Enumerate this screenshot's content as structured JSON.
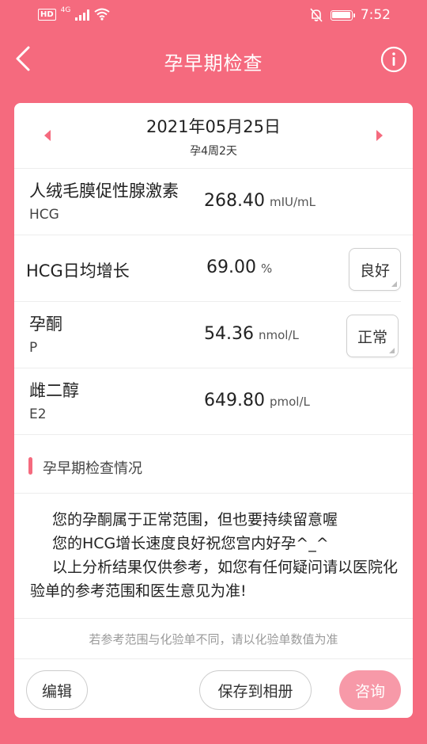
{
  "status_bar": {
    "hd": "HD",
    "network": "4G",
    "time": "7:52"
  },
  "header": {
    "title": "孕早期检查"
  },
  "date": {
    "text": "2021年05月25日",
    "week": "孕4周2天"
  },
  "tests": [
    {
      "name": "人绒毛膜促性腺激素",
      "sub": "HCG",
      "value": "268.40",
      "unit": "mIU/mL"
    },
    {
      "name": "HCG日均增长",
      "value": "69.00",
      "unit": "%",
      "badge": "良好"
    },
    {
      "name": "孕酮",
      "sub": "P",
      "value": "54.36",
      "unit": "nmol/L",
      "badge": "正常"
    },
    {
      "name": "雌二醇",
      "sub": "E2",
      "value": "649.80",
      "unit": "pmol/L"
    }
  ],
  "section": {
    "title": "孕早期检查情况"
  },
  "analysis": {
    "line1": "您的孕酮属于正常范围，但也要持续留意喔",
    "line2": "您的HCG增长速度良好祝您宫内好孕^_^",
    "line3": "以上分析结果仅供参考，如您有任何疑问请以医院化验单的参考范围和医生意见为准!"
  },
  "note": "若参考范围与化验单不同，请以化验单数值为准",
  "buttons": {
    "edit": "编辑",
    "save": "保存到相册",
    "consult": "咨询"
  },
  "colors": {
    "accent": "#F56A7E",
    "consult_button": "#F799A8"
  }
}
